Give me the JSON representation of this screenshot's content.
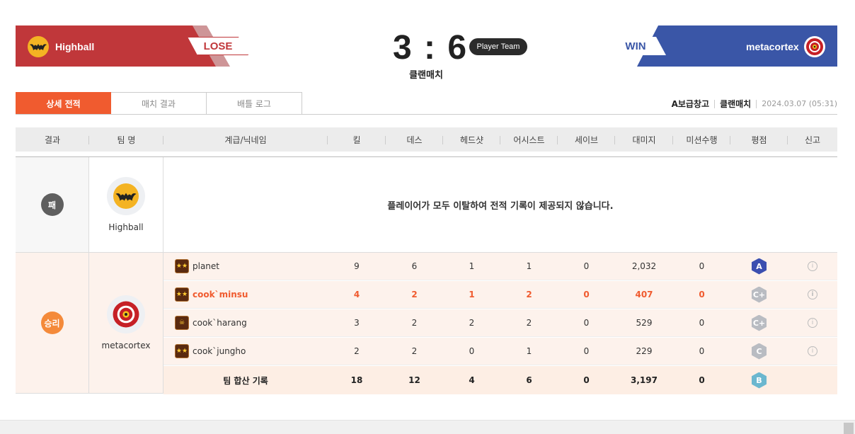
{
  "header": {
    "left_team": {
      "name": "Highball",
      "result": "LOSE",
      "emblem": "bat-emblem-icon",
      "color": "#c0373a"
    },
    "right_team": {
      "name": "metacortex",
      "result": "WIN",
      "emblem": "flower-emblem-icon",
      "color": "#3a56a7"
    },
    "score": "3 : 6",
    "badge": "Player Team",
    "match_type": "클랜매치"
  },
  "tabs": [
    {
      "label": "상세 전적",
      "active": true
    },
    {
      "label": "매치 결과",
      "active": false
    },
    {
      "label": "배틀 로그",
      "active": false
    }
  ],
  "meta": {
    "map": "A보급창고",
    "mode": "클랜매치",
    "datetime": "2024.03.07 (05:31)"
  },
  "columns": [
    "결과",
    "팀 명",
    "계급/닉네임",
    "킬",
    "데스",
    "헤드샷",
    "어시스트",
    "세이브",
    "대미지",
    "미션수행",
    "평점",
    "신고"
  ],
  "lose_team": {
    "result": "패",
    "name": "Highball",
    "message": "플레이어가 모두 이탈하여 전적 기록이 제공되지 않습니다."
  },
  "win_team": {
    "result": "승리",
    "name": "metacortex",
    "players": [
      {
        "nick": "planet",
        "kill": "9",
        "death": "6",
        "headshot": "1",
        "assist": "1",
        "save": "0",
        "damage": "2,032",
        "mission": "0",
        "grade": "A",
        "grade_color": "#3b4fb0",
        "rank_icon": "rank-star-icon",
        "me": false
      },
      {
        "nick": "cook`minsu",
        "kill": "4",
        "death": "2",
        "headshot": "1",
        "assist": "2",
        "save": "0",
        "damage": "407",
        "mission": "0",
        "grade": "C+",
        "grade_color": "#b9bcc2",
        "rank_icon": "rank-star-icon",
        "me": true
      },
      {
        "nick": "cook`harang",
        "kill": "3",
        "death": "2",
        "headshot": "2",
        "assist": "2",
        "save": "0",
        "damage": "529",
        "mission": "0",
        "grade": "C+",
        "grade_color": "#b9bcc2",
        "rank_icon": "rank-skull-icon",
        "me": false
      },
      {
        "nick": "cook`jungho",
        "kill": "2",
        "death": "2",
        "headshot": "0",
        "assist": "1",
        "save": "0",
        "damage": "229",
        "mission": "0",
        "grade": "C",
        "grade_color": "#b9bcc2",
        "rank_icon": "rank-star-icon",
        "me": false
      }
    ],
    "total": {
      "label": "팀 합산 기록",
      "kill": "18",
      "death": "12",
      "headshot": "4",
      "assist": "6",
      "save": "0",
      "damage": "3,197",
      "mission": "0",
      "grade": "B",
      "grade_color": "#6bb7cf"
    }
  }
}
